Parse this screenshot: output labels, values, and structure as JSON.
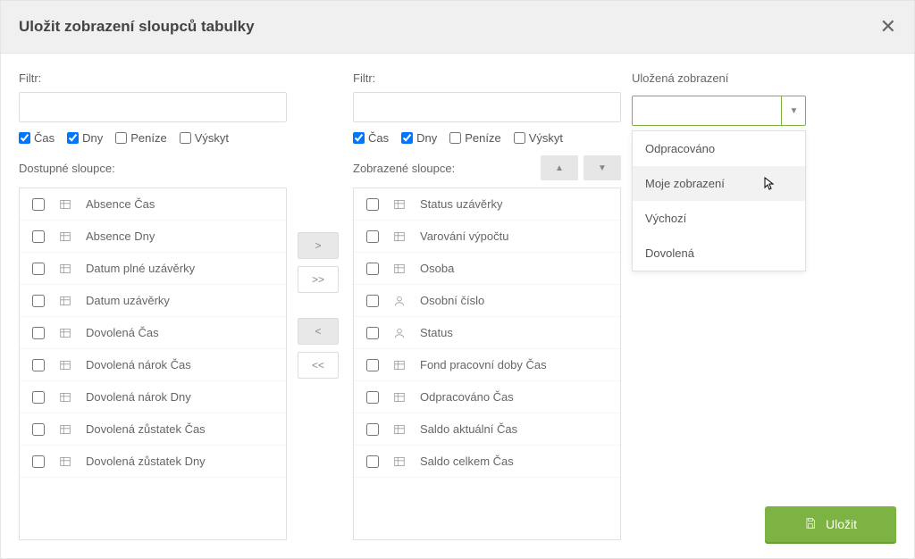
{
  "header": {
    "title": "Uložit zobrazení sloupců tabulky"
  },
  "left": {
    "filter_label": "Filtr:",
    "checks": {
      "cas": "Čas",
      "cas_checked": true,
      "dny": "Dny",
      "dny_checked": true,
      "penize": "Peníze",
      "penize_checked": false,
      "vyskyt": "Výskyt",
      "vyskyt_checked": false
    },
    "section_label": "Dostupné sloupce:",
    "items": [
      {
        "label": "Absence Čas",
        "icon": "table"
      },
      {
        "label": "Absence Dny",
        "icon": "table"
      },
      {
        "label": "Datum plné uzávěrky",
        "icon": "table"
      },
      {
        "label": "Datum uzávěrky",
        "icon": "table"
      },
      {
        "label": "Dovolená Čas",
        "icon": "table"
      },
      {
        "label": "Dovolená nárok Čas",
        "icon": "table"
      },
      {
        "label": "Dovolená nárok Dny",
        "icon": "table"
      },
      {
        "label": "Dovolená zůstatek Čas",
        "icon": "table"
      },
      {
        "label": "Dovolená zůstatek Dny",
        "icon": "table"
      }
    ]
  },
  "center": {
    "filter_label": "Filtr:",
    "checks": {
      "cas": "Čas",
      "cas_checked": true,
      "dny": "Dny",
      "dny_checked": true,
      "penize": "Peníze",
      "penize_checked": false,
      "vyskyt": "Výskyt",
      "vyskyt_checked": false
    },
    "section_label": "Zobrazené sloupce:",
    "items": [
      {
        "label": "Status uzávěrky",
        "icon": "table"
      },
      {
        "label": "Varování výpočtu",
        "icon": "table"
      },
      {
        "label": "Osoba",
        "icon": "table"
      },
      {
        "label": "Osobní číslo",
        "icon": "person"
      },
      {
        "label": "Status",
        "icon": "person"
      },
      {
        "label": "Fond pracovní doby Čas",
        "icon": "table"
      },
      {
        "label": "Odpracováno Čas",
        "icon": "table"
      },
      {
        "label": "Saldo aktuální Čas",
        "icon": "table"
      },
      {
        "label": "Saldo celkem Čas",
        "icon": "table"
      }
    ]
  },
  "move_buttons": {
    "right": ">",
    "right_all": ">>",
    "left": "<",
    "left_all": "<<"
  },
  "right": {
    "label": "Uložená zobrazení",
    "options": [
      {
        "label": "Odpracováno",
        "hover": false
      },
      {
        "label": "Moje zobrazení",
        "hover": true
      },
      {
        "label": "Výchozí",
        "hover": false
      },
      {
        "label": "Dovolená",
        "hover": false
      }
    ]
  },
  "footer": {
    "save": "Uložit"
  }
}
